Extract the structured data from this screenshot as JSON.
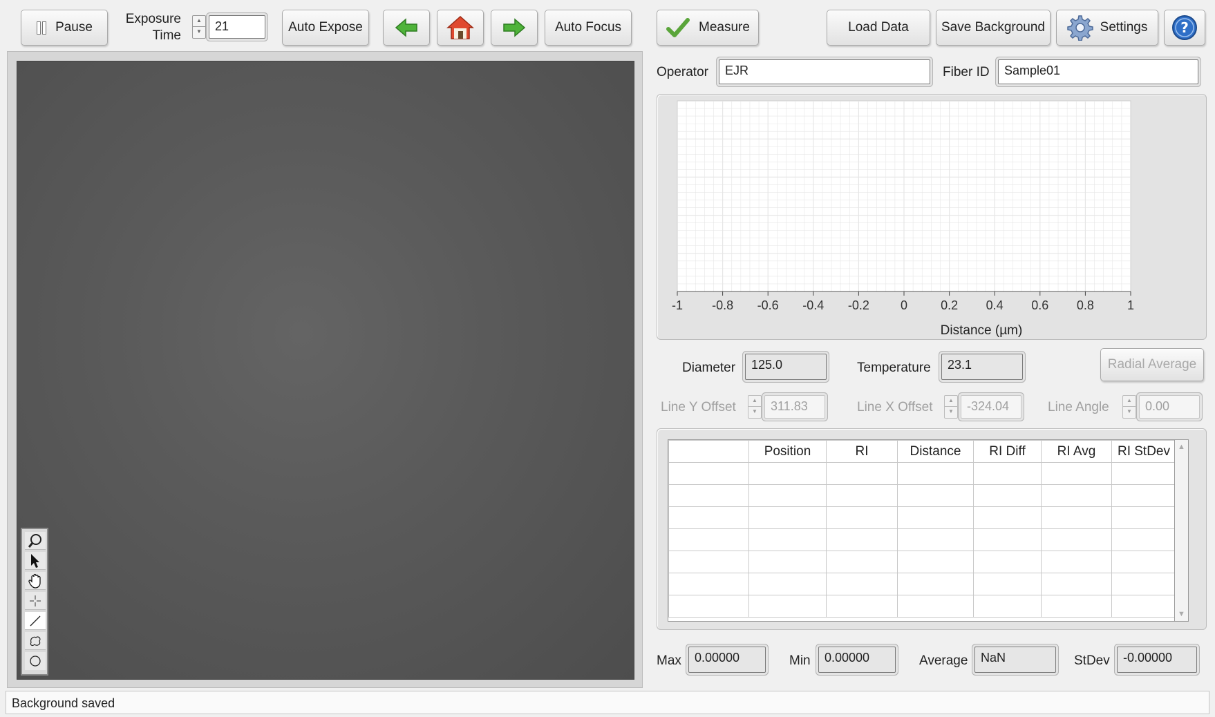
{
  "toolbar": {
    "pause_label": "Pause",
    "exposure_label_line1": "Exposure",
    "exposure_label_line2": "Time",
    "exposure_value": "21",
    "auto_expose_label": "Auto Expose",
    "auto_focus_label": "Auto Focus",
    "measure_label": "Measure",
    "load_data_label": "Load Data",
    "save_background_label": "Save Background",
    "settings_label": "Settings"
  },
  "form": {
    "operator_label": "Operator",
    "operator_value": "EJR",
    "fiber_id_label": "Fiber ID",
    "fiber_id_value": "Sample01"
  },
  "graph": {
    "xlabel": "Distance (µm)",
    "ticks": [
      "-1",
      "-0.8",
      "-0.6",
      "-0.4",
      "-0.2",
      "0",
      "0.2",
      "0.4",
      "0.6",
      "0.8",
      "1"
    ]
  },
  "chart_data": {
    "type": "line",
    "title": "",
    "xlabel": "Distance (µm)",
    "ylabel": "",
    "xlim": [
      -1,
      1
    ],
    "x_ticks": [
      -1,
      -0.8,
      -0.6,
      -0.4,
      -0.2,
      0,
      0.2,
      0.4,
      0.6,
      0.8,
      1
    ],
    "series": [],
    "grid": true
  },
  "measurements": {
    "diameter_label": "Diameter",
    "diameter_value": "125.0",
    "temperature_label": "Temperature",
    "temperature_value": "23.1",
    "radial_average_label": "Radial Average",
    "line_y_offset_label": "Line Y Offset",
    "line_y_offset_value": "311.83",
    "line_x_offset_label": "Line X Offset",
    "line_x_offset_value": "-324.04",
    "line_angle_label": "Line Angle",
    "line_angle_value": "0.00"
  },
  "table": {
    "columns": [
      "",
      "Position",
      "RI",
      "Distance",
      "RI Diff",
      "RI Avg",
      "RI StDev"
    ]
  },
  "stats": {
    "max_label": "Max",
    "max_value": "0.00000",
    "min_label": "Min",
    "min_value": "0.00000",
    "average_label": "Average",
    "average_value": "NaN",
    "stdev_label": "StDev",
    "stdev_value": "-0.00000"
  },
  "status": {
    "message": "Background saved"
  },
  "colors": {
    "image_bg": "#555555",
    "arrow_green": "#4fb33a",
    "home_red": "#e04a2f",
    "help_blue": "#2f6fc7",
    "grid_line": "#e6e6e6"
  },
  "icons": {
    "pause": "pause-icon",
    "back": "arrow-left-icon",
    "home": "home-icon",
    "forward": "arrow-right-icon",
    "measure": "checkmark-icon",
    "settings": "gear-icon",
    "help": "help-icon",
    "tools": [
      "zoom-icon",
      "pointer-icon",
      "pan-icon",
      "crosshair-icon",
      "line-icon",
      "freehand-roi-icon",
      "oval-icon"
    ]
  }
}
